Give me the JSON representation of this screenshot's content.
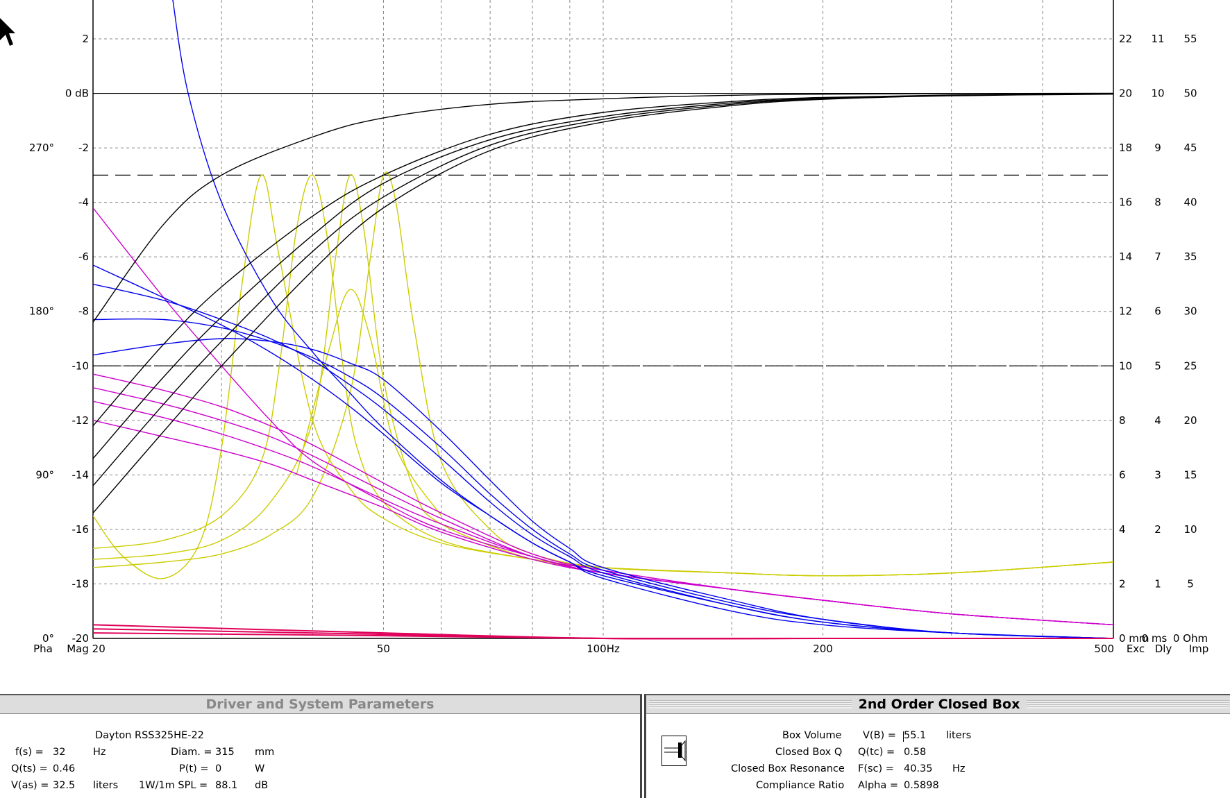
{
  "plot": {
    "x_ticks": [
      "Mag 20",
      "50",
      "100Hz",
      "200",
      "500"
    ],
    "left_db_labels": [
      "2",
      "0 dB",
      "-2",
      "-4",
      "-6",
      "-8",
      "-10",
      "-12",
      "-14",
      "-16",
      "-18",
      "-20"
    ],
    "phase_labels": [
      "270°",
      "180°",
      "90°",
      "0°"
    ],
    "right_col1": [
      "22",
      "20",
      "18",
      "16",
      "14",
      "12",
      "10",
      "8",
      "6",
      "4",
      "2",
      "0 mm"
    ],
    "right_col2": [
      "11",
      "10",
      "9",
      "8",
      "7",
      "6",
      "5",
      "4",
      "3",
      "2",
      "1",
      "0 ms"
    ],
    "right_col3": [
      "55",
      "50",
      "45",
      "40",
      "35",
      "30",
      "25",
      "20",
      "15",
      "10",
      "5",
      "0 Ohm"
    ],
    "legend_left": "Pha",
    "legend_exc": "Exc",
    "legend_dly": "Dly",
    "legend_imp": "Imp",
    "colors": {
      "mag": "#000000",
      "phase": "#cc00cc",
      "exc": "#e0005a",
      "dly": "#0000ee",
      "imp": "#cccc00",
      "grid": "#888888"
    }
  },
  "chart_data": {
    "type": "line",
    "title": "",
    "xlabel": "",
    "ylabel": "",
    "xscale": "log",
    "xlim": [
      20,
      500
    ],
    "ylim": [
      -20,
      3
    ],
    "grid": true,
    "series": [
      {
        "kind": "mag",
        "x": [
          20,
          25,
          30,
          40,
          50,
          70,
          100,
          150,
          200,
          300,
          500
        ],
        "y": [
          -8.4,
          -4.8,
          -3.0,
          -1.6,
          -0.9,
          -0.4,
          -0.2,
          -0.07,
          -0.03,
          -0.01,
          0
        ]
      },
      {
        "kind": "mag",
        "x": [
          20,
          25,
          30,
          40,
          50,
          70,
          100,
          150,
          200,
          300,
          500
        ],
        "y": [
          -12.2,
          -9.2,
          -7.1,
          -4.5,
          -3.0,
          -1.5,
          -0.7,
          -0.3,
          -0.15,
          -0.06,
          -0.01
        ]
      },
      {
        "kind": "mag",
        "x": [
          20,
          25,
          30,
          40,
          50,
          70,
          100,
          150,
          200,
          300,
          500
        ],
        "y": [
          -13.4,
          -10.4,
          -8.2,
          -5.2,
          -3.3,
          -1.7,
          -0.85,
          -0.35,
          -0.18,
          -0.07,
          -0.02
        ]
      },
      {
        "kind": "mag",
        "x": [
          20,
          25,
          30,
          40,
          50,
          70,
          100,
          150,
          200,
          300,
          500
        ],
        "y": [
          -14.4,
          -11.4,
          -9.1,
          -5.8,
          -3.8,
          -1.9,
          -0.95,
          -0.4,
          -0.2,
          -0.08,
          -0.02
        ]
      },
      {
        "kind": "mag",
        "x": [
          20,
          25,
          30,
          40,
          50,
          70,
          100,
          150,
          200,
          300,
          500
        ],
        "y": [
          -15.4,
          -12.4,
          -10.0,
          -6.5,
          -4.2,
          -2.1,
          -1.05,
          -0.45,
          -0.22,
          -0.09,
          -0.03
        ]
      },
      {
        "kind": "imp",
        "x": [
          20,
          22,
          25,
          28,
          30,
          32,
          34,
          36,
          40,
          45,
          50,
          60,
          80,
          100,
          150,
          200,
          300,
          500
        ],
        "y": [
          -15.5,
          -17.0,
          -17.8,
          -16.5,
          -13.0,
          -7.0,
          -3.0,
          -6.0,
          -12.0,
          -14.5,
          -15.6,
          -16.5,
          -17.1,
          -17.4,
          -17.6,
          -17.7,
          -17.6,
          -17.2
        ]
      },
      {
        "kind": "imp",
        "x": [
          20,
          25,
          30,
          34,
          36,
          38,
          40,
          42,
          44,
          46,
          50,
          60,
          80,
          100,
          150,
          200,
          300,
          500
        ],
        "y": [
          -16.7,
          -16.4,
          -15.5,
          -13.5,
          -10.0,
          -5.0,
          -3.0,
          -5.5,
          -10.0,
          -13.0,
          -15.0,
          -16.4,
          -17.1,
          -17.4,
          -17.6,
          -17.7,
          -17.6,
          -17.2
        ]
      },
      {
        "kind": "imp",
        "x": [
          20,
          25,
          30,
          35,
          40,
          43,
          45,
          47,
          50,
          55,
          60,
          80,
          100,
          150,
          200,
          300,
          500
        ],
        "y": [
          -17.1,
          -16.9,
          -16.4,
          -15.0,
          -12.0,
          -6.0,
          -3.0,
          -5.0,
          -10.5,
          -14.5,
          -15.8,
          -17.1,
          -17.4,
          -17.6,
          -17.7,
          -17.6,
          -17.2
        ]
      },
      {
        "kind": "imp",
        "x": [
          20,
          25,
          30,
          35,
          40,
          45,
          48,
          50,
          52,
          55,
          60,
          70,
          80,
          100,
          150,
          200,
          300,
          500
        ],
        "y": [
          -17.4,
          -17.2,
          -16.9,
          -16.2,
          -14.8,
          -11.0,
          -6.0,
          -3.0,
          -4.0,
          -8.5,
          -13.5,
          -16.0,
          -16.9,
          -17.4,
          -17.6,
          -17.7,
          -17.6,
          -17.2
        ]
      },
      {
        "kind": "imp",
        "x": [
          38,
          42,
          45,
          48,
          52,
          60
        ],
        "y": [
          -14.0,
          -9.5,
          -7.2,
          -9.0,
          -13.0,
          -15.5
        ]
      },
      {
        "kind": "dly",
        "x": [
          25.7,
          27,
          30,
          35,
          40,
          45,
          50,
          60,
          70,
          80,
          90,
          100,
          150,
          200,
          300,
          500
        ],
        "y": [
          3.5,
          0,
          -4.0,
          -7.5,
          -9.5,
          -11.0,
          -12.3,
          -14.2,
          -15.5,
          -16.5,
          -17.2,
          -17.8,
          -19.0,
          -19.5,
          -19.8,
          -20.0
        ]
      },
      {
        "kind": "dly",
        "x": [
          20,
          25,
          30,
          35,
          40,
          45,
          50,
          60,
          70,
          80,
          90,
          100,
          150,
          200,
          300,
          500
        ],
        "y": [
          -6.3,
          -7.5,
          -8.5,
          -9.5,
          -10.5,
          -11.5,
          -12.5,
          -14.3,
          -15.5,
          -16.5,
          -17.2,
          -17.7,
          -18.8,
          -19.4,
          -19.8,
          -20.0
        ]
      },
      {
        "kind": "dly",
        "x": [
          20,
          25,
          30,
          35,
          40,
          45,
          50,
          60,
          70,
          80,
          90,
          100,
          150,
          200,
          300,
          500
        ],
        "y": [
          -7.0,
          -7.6,
          -8.3,
          -9.0,
          -9.8,
          -10.7,
          -11.6,
          -13.4,
          -15.0,
          -16.2,
          -17.0,
          -17.6,
          -18.8,
          -19.4,
          -19.8,
          -20.0
        ]
      },
      {
        "kind": "dly",
        "x": [
          20,
          25,
          30,
          35,
          40,
          45,
          50,
          60,
          70,
          80,
          90,
          100,
          150,
          200,
          300,
          500
        ],
        "y": [
          -8.3,
          -8.3,
          -8.6,
          -9.1,
          -9.7,
          -10.4,
          -11.2,
          -13.0,
          -14.7,
          -16.0,
          -16.9,
          -17.5,
          -18.7,
          -19.3,
          -19.8,
          -20.0
        ]
      },
      {
        "kind": "dly",
        "x": [
          20,
          25,
          30,
          35,
          40,
          45,
          50,
          60,
          70,
          80,
          90,
          100,
          150,
          200,
          300,
          500
        ],
        "y": [
          -9.6,
          -9.2,
          -9.0,
          -9.1,
          -9.4,
          -9.9,
          -10.5,
          -12.4,
          -14.2,
          -15.7,
          -16.7,
          -17.4,
          -18.6,
          -19.3,
          -19.8,
          -20.0
        ]
      },
      {
        "kind": "phase",
        "x": [
          20,
          25,
          30,
          35,
          40,
          50,
          60,
          80,
          100,
          150,
          200,
          300,
          500
        ],
        "y": [
          -4.2,
          -7.5,
          -10.0,
          -12.0,
          -13.5,
          -15.0,
          -16.0,
          -17.0,
          -17.6,
          -18.2,
          -18.6,
          -19.1,
          -19.5
        ]
      },
      {
        "kind": "phase",
        "x": [
          20,
          25,
          30,
          35,
          40,
          50,
          60,
          80,
          100,
          150,
          200,
          300,
          500
        ],
        "y": [
          -10.3,
          -10.9,
          -11.5,
          -12.2,
          -12.9,
          -14.3,
          -15.4,
          -16.9,
          -17.5,
          -18.2,
          -18.6,
          -19.1,
          -19.5
        ]
      },
      {
        "kind": "phase",
        "x": [
          20,
          25,
          30,
          35,
          40,
          50,
          60,
          80,
          100,
          150,
          200,
          300,
          500
        ],
        "y": [
          -10.8,
          -11.4,
          -12.0,
          -12.6,
          -13.3,
          -14.6,
          -15.6,
          -17.0,
          -17.5,
          -18.2,
          -18.6,
          -19.1,
          -19.5
        ]
      },
      {
        "kind": "phase",
        "x": [
          20,
          25,
          30,
          35,
          40,
          50,
          60,
          80,
          100,
          150,
          200,
          300,
          500
        ],
        "y": [
          -11.3,
          -11.9,
          -12.5,
          -13.1,
          -13.7,
          -14.9,
          -15.8,
          -17.0,
          -17.6,
          -18.2,
          -18.6,
          -19.1,
          -19.5
        ]
      },
      {
        "kind": "phase",
        "x": [
          20,
          25,
          30,
          35,
          40,
          50,
          60,
          80,
          100,
          150,
          200,
          300,
          500
        ],
        "y": [
          -12.0,
          -12.6,
          -13.1,
          -13.6,
          -14.2,
          -15.2,
          -16.1,
          -17.1,
          -17.6,
          -18.2,
          -18.6,
          -19.1,
          -19.5
        ]
      },
      {
        "kind": "exc",
        "x": [
          20,
          50,
          100,
          200,
          500
        ],
        "y": [
          -19.5,
          -19.8,
          -20.0,
          -20.0,
          -20.0
        ]
      },
      {
        "kind": "exc",
        "x": [
          20,
          50,
          100,
          200,
          500
        ],
        "y": [
          -19.65,
          -19.85,
          -20.0,
          -20.0,
          -20.0
        ]
      },
      {
        "kind": "exc",
        "x": [
          20,
          50,
          100,
          200,
          500
        ],
        "y": [
          -19.8,
          -19.9,
          -20.0,
          -20.0,
          -20.0
        ]
      }
    ]
  },
  "driver_panel": {
    "title": "Driver and System Parameters",
    "driver_name": "Dayton  RSS325HE-22",
    "fs_label": "f(s) =",
    "fs_value": "32",
    "fs_unit": "Hz",
    "qts_label": "Q(ts) =",
    "qts_value": "0.46",
    "vas_label": "V(as) =",
    "vas_value": "32.5",
    "vas_unit": "liters",
    "diam_label": "Diam. =",
    "diam_value": "315",
    "diam_unit": "mm",
    "pt_label": "P(t) =",
    "pt_value": "0",
    "pt_unit": "W",
    "spl_label": "1W/1m SPL =",
    "spl_value": "88.1",
    "spl_unit": "dB"
  },
  "box_panel": {
    "title": "2nd Order Closed Box",
    "row1_name": "Box Volume",
    "row1_label": "V(B) =",
    "row1_value": "55.1",
    "row1_unit": "liters",
    "row2_name": "Closed Box Q",
    "row2_label": "Q(tc) =",
    "row2_value": "0.58",
    "row3_name": "Closed Box Resonance",
    "row3_label": "F(sc) =",
    "row3_value": "40.35",
    "row3_unit": "Hz",
    "row4_name": "Compliance Ratio",
    "row4_label": "Alpha =",
    "row4_value": "0.5898"
  }
}
